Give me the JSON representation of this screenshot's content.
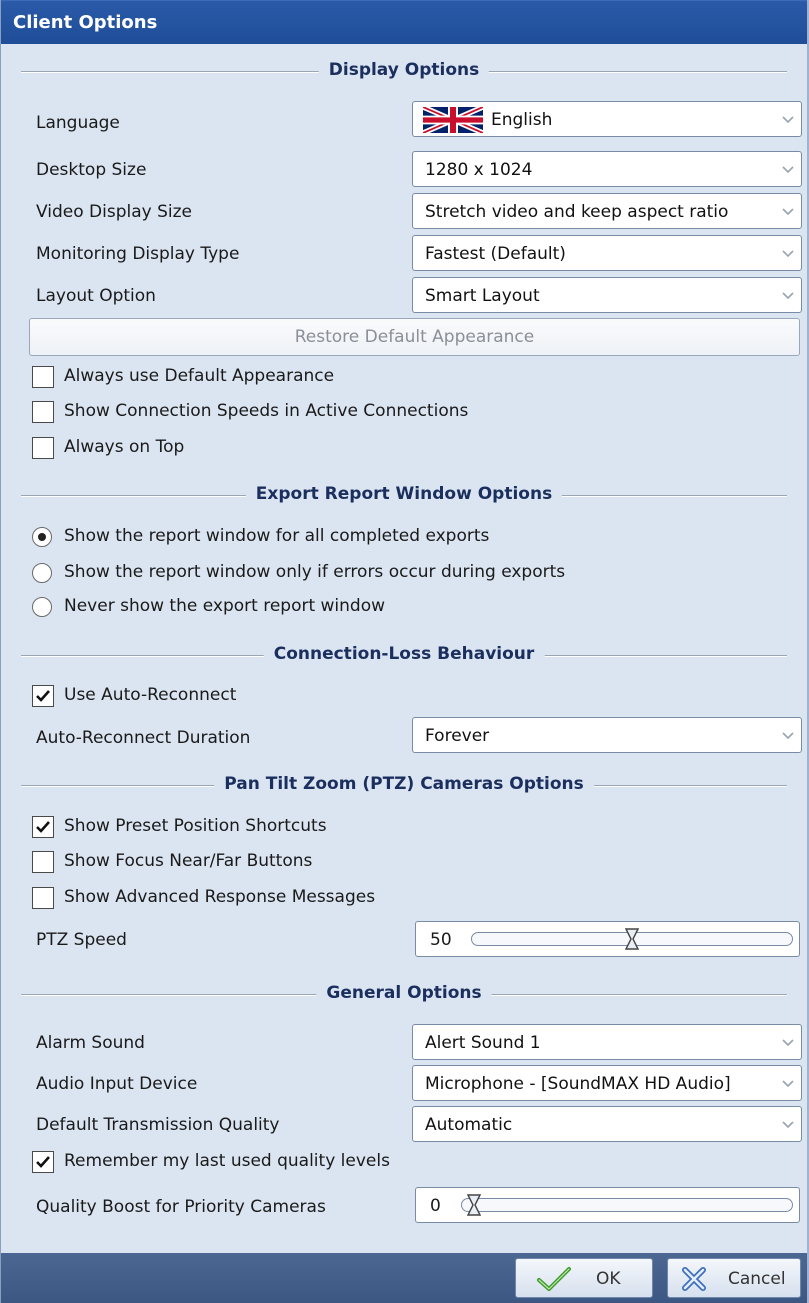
{
  "window": {
    "title": "Client Options"
  },
  "display": {
    "heading": "Display Options",
    "language_label": "Language",
    "language_value": "English",
    "desktop_size_label": "Desktop Size",
    "desktop_size_value": "1280 x 1024",
    "video_display_label": "Video Display Size",
    "video_display_value": "Stretch video and keep aspect ratio",
    "monitoring_type_label": "Monitoring Display Type",
    "monitoring_type_value": "Fastest (Default)",
    "layout_label": "Layout Option",
    "layout_value": "Smart Layout",
    "restore_label": "Restore Default Appearance",
    "checkboxes": [
      {
        "label": "Always use Default Appearance",
        "checked": false
      },
      {
        "label": "Show Connection Speeds in Active Connections",
        "checked": false
      },
      {
        "label": "Always on Top",
        "checked": false
      }
    ]
  },
  "export": {
    "heading": "Export Report Window Options",
    "radios": [
      {
        "label": "Show the report window for all completed exports",
        "selected": true
      },
      {
        "label": "Show the report window only if errors occur during exports",
        "selected": false
      },
      {
        "label": "Never show the export report window",
        "selected": false
      }
    ]
  },
  "connection": {
    "heading": "Connection-Loss Behaviour",
    "auto_reconnect_label": "Use Auto-Reconnect",
    "auto_reconnect_checked": true,
    "duration_label": "Auto-Reconnect Duration",
    "duration_value": "Forever"
  },
  "ptz": {
    "heading": "Pan Tilt Zoom (PTZ) Cameras Options",
    "checkboxes": [
      {
        "label": "Show Preset Position Shortcuts",
        "checked": true
      },
      {
        "label": "Show Focus Near/Far Buttons",
        "checked": false
      },
      {
        "label": "Show Advanced Response Messages",
        "checked": false
      }
    ],
    "speed_label": "PTZ Speed",
    "speed_value": "50",
    "speed_fraction": 0.5
  },
  "general": {
    "heading": "General Options",
    "alarm_label": "Alarm Sound",
    "alarm_value": "Alert Sound 1",
    "audio_label": "Audio Input Device",
    "audio_value": "Microphone - [SoundMAX HD Audio]",
    "quality_label": "Default Transmission Quality",
    "quality_value": "Automatic",
    "remember_label": "Remember my last used quality levels",
    "remember_checked": true,
    "boost_label": "Quality Boost for Priority Cameras",
    "boost_value": "0",
    "boost_fraction": 0
  },
  "footer": {
    "ok_label": "OK",
    "cancel_label": "Cancel"
  },
  "colors": {
    "title_bar": "#1f4d98",
    "panel": "#dbe4f1",
    "heading_text": "#1b2f5e",
    "footer": "#3c5882"
  },
  "icons": {
    "ok": "checkmark-icon",
    "cancel": "close-x-icon",
    "dropdown": "chevron-down-icon",
    "language": "uk-flag-icon"
  }
}
